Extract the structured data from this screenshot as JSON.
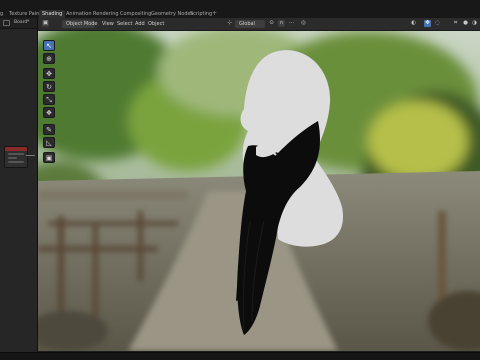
{
  "workspace_tabs": [
    {
      "label": "g",
      "active": false
    },
    {
      "label": "Texture Paint",
      "active": false
    },
    {
      "label": "Shading",
      "active": true
    },
    {
      "label": "Animation",
      "active": false
    },
    {
      "label": "Rendering",
      "active": false
    },
    {
      "label": "Compositing",
      "active": false
    },
    {
      "label": "Geometry Nodes",
      "active": false
    },
    {
      "label": "Scripting",
      "active": false
    }
  ],
  "add_workspace_label": "+",
  "left_panel": {
    "editor_label": "Board",
    "chevron": "▾"
  },
  "viewport_header": {
    "editor_type_icon": "▣",
    "mode_label": "Object Mode",
    "menus": [
      "View",
      "Select",
      "Add",
      "Object"
    ],
    "orientation_label": "Global",
    "orientation_icon": "⊹",
    "pivot_icon": "⊙",
    "snap_icon": "∩",
    "snap_toggle_icon": "⋯",
    "proportional_icon": "◎",
    "overlay_icon": "◌",
    "gizmo_icon": "✥",
    "visibility_icon": "◐",
    "shading_wire_icon": "⌗",
    "shading_solid_icon": "●"
  },
  "toolbar_tools": [
    {
      "name": "select",
      "icon": "↖",
      "active": true
    },
    {
      "name": "cursor",
      "icon": "⊕",
      "active": false
    },
    {
      "name": "move",
      "icon": "✥",
      "active": false
    },
    {
      "name": "rotate",
      "icon": "↻",
      "active": false
    },
    {
      "name": "scale",
      "icon": "⤡",
      "active": false
    },
    {
      "name": "transform",
      "icon": "❖",
      "active": false
    },
    {
      "name": "annotate",
      "icon": "✎",
      "active": false
    },
    {
      "name": "measure",
      "icon": "◺",
      "active": false
    },
    {
      "name": "add-cube",
      "icon": "▣",
      "active": false
    }
  ],
  "colors": {
    "accent": "#4772b3",
    "head_model": "#dddddd",
    "beard_hair": "#0c0c0c",
    "node_header": "#8a2b2b"
  }
}
